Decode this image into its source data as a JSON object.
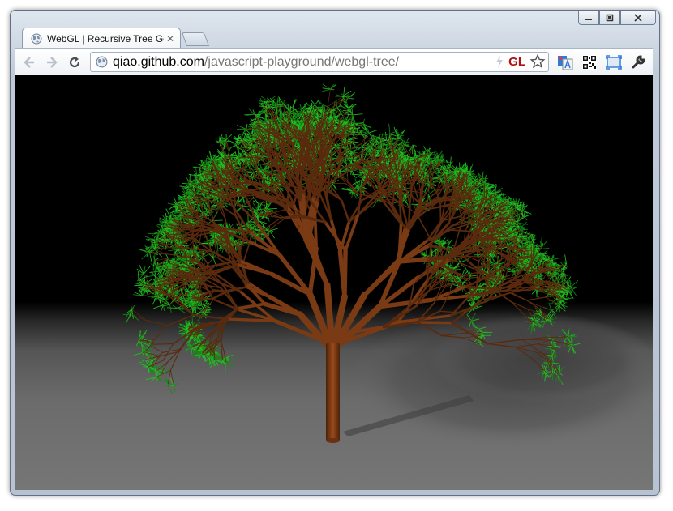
{
  "window": {
    "controls": [
      "minimize",
      "maximize",
      "close"
    ]
  },
  "tab": {
    "title": "WebGL | Recursive Tree Ger",
    "close_glyph": "✕",
    "favicon": "globe-icon"
  },
  "toolbar": {
    "back_icon": "back-arrow-icon",
    "forward_icon": "forward-arrow-icon",
    "reload_icon": "reload-icon",
    "url_host": "qiao.github.com",
    "url_path": "/javascript-playground/webgl-tree/",
    "gl_label": "GL",
    "extensions": [
      "translate-icon",
      "qr-code-icon",
      "fullscreen-icon",
      "wrench-icon"
    ]
  },
  "colors": {
    "background": "#000000",
    "ground": "#6e6e6e",
    "trunk": "#7a3a14",
    "leaves": "#1fbf1f",
    "gl_red": "#b01010"
  }
}
